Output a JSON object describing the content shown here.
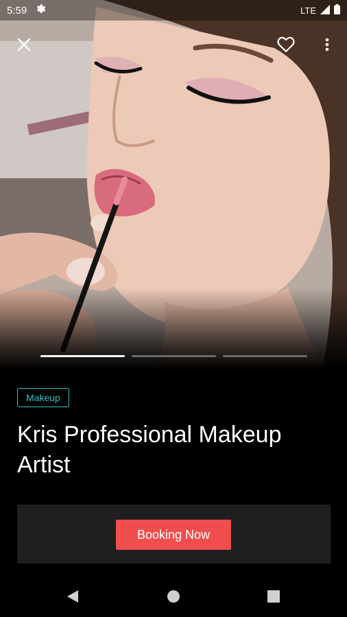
{
  "status_bar": {
    "time": "5:59",
    "network": "LTE",
    "icons": [
      "settings-icon",
      "signal-icon",
      "battery-icon"
    ]
  },
  "top_bar": {
    "icons": [
      "close-icon",
      "heart-outline-icon",
      "more-vertical-icon"
    ]
  },
  "hero": {
    "image_description_icon": "makeup-photo",
    "carousel": {
      "total": 3,
      "active": 1
    }
  },
  "listing": {
    "category": "Makeup",
    "title": "Kris Professional Makeup Artist"
  },
  "booking": {
    "button_label": "Booking Now"
  },
  "nav_bar": {
    "icons": [
      "back-icon",
      "home-icon",
      "recents-icon"
    ]
  },
  "colors": {
    "accent_tag": "#2ec4c0",
    "booking_button": "#f04e4e",
    "panel": "#1f1f1f",
    "background": "#000000"
  }
}
